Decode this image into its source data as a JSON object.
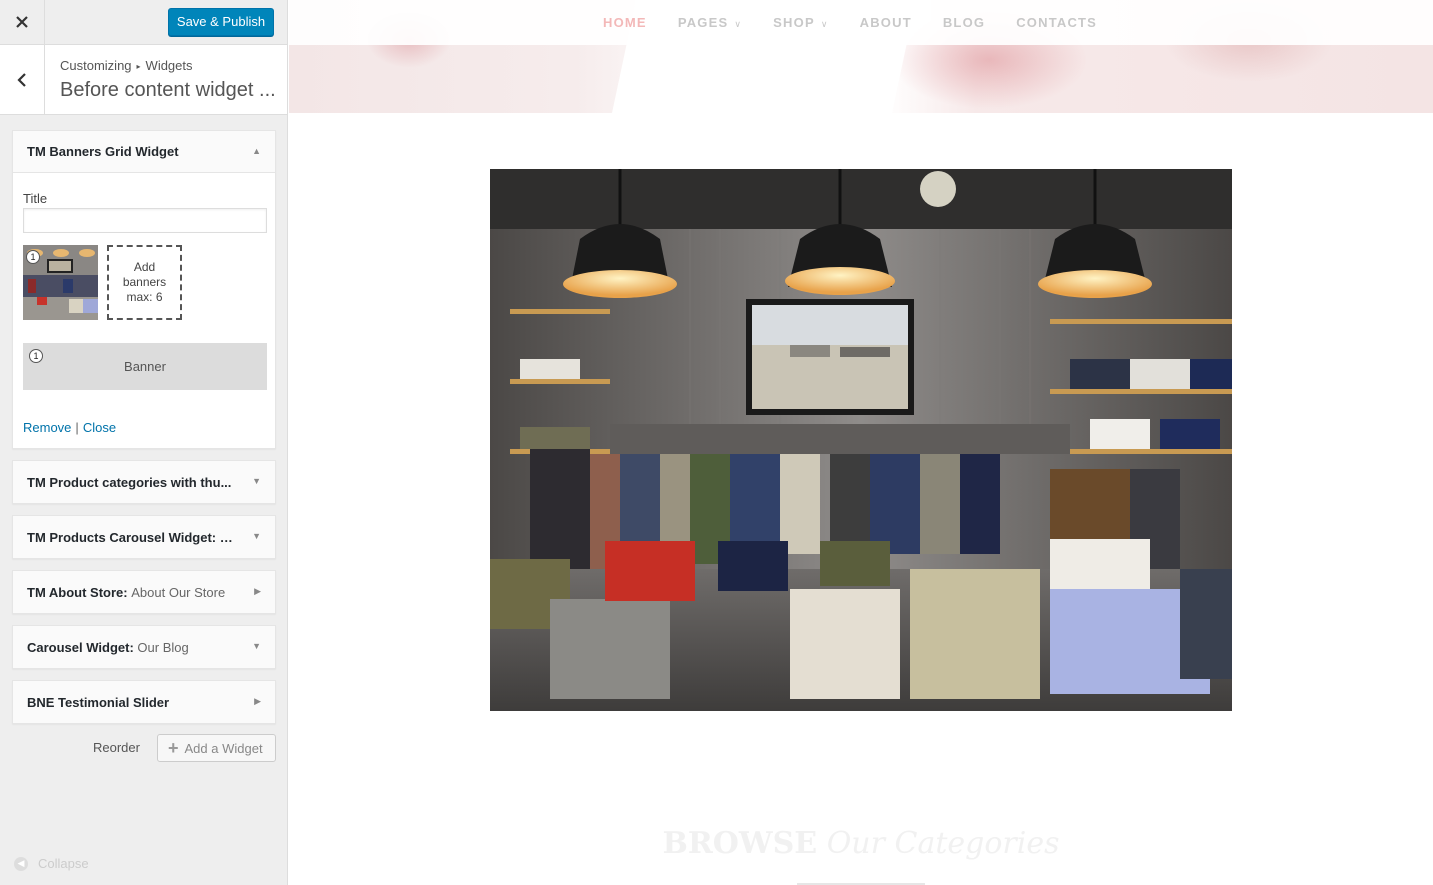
{
  "sidebar": {
    "publish_label": "Save & Publish",
    "breadcrumb": {
      "root": "Customizing",
      "separator": "▸",
      "section": "Widgets"
    },
    "section_title": "Before content widget ...",
    "open_widget": {
      "title": "TM Banners Grid Widget",
      "title_field_label": "Title",
      "title_field_value": "",
      "banner_thumb_number": "1",
      "add_banners_line1": "Add",
      "add_banners_line2": "banners",
      "add_banners_line3": "max: 6",
      "banner_item_number": "1",
      "banner_item_label": "Banner",
      "remove_label": "Remove",
      "separator": "|",
      "close_label": "Close"
    },
    "widgets": [
      {
        "title": "TM Product categories with thu...",
        "subtitle": ""
      },
      {
        "title": "TM Products Carousel Widget: W...",
        "subtitle": ""
      },
      {
        "title": "TM About Store:",
        "subtitle": "About Our Store"
      },
      {
        "title": "Carousel Widget:",
        "subtitle": "Our Blog"
      },
      {
        "title": "BNE Testimonial Slider",
        "subtitle": ""
      }
    ],
    "reorder_label": "Reorder",
    "add_widget_label": "Add a Widget",
    "collapse_label": "Collapse"
  },
  "preview": {
    "nav": [
      {
        "label": "HOME",
        "active": true,
        "dropdown": false
      },
      {
        "label": "PAGES",
        "active": false,
        "dropdown": true
      },
      {
        "label": "SHOP",
        "active": false,
        "dropdown": true
      },
      {
        "label": "ABOUT",
        "active": false,
        "dropdown": false
      },
      {
        "label": "BLOG",
        "active": false,
        "dropdown": false
      },
      {
        "label": "CONTACTS",
        "active": false,
        "dropdown": false
      }
    ],
    "browse_bold": "BROWSE",
    "browse_italic": "Our Categories"
  },
  "colors": {
    "accent": "#0085ba",
    "link": "#0073aa",
    "nav_active": "#f3b8b8"
  }
}
